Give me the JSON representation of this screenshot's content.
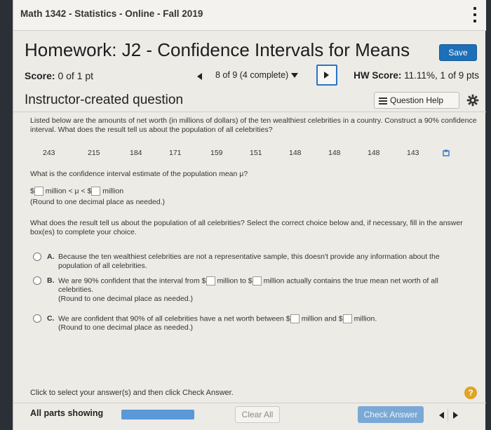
{
  "course": {
    "title": "Math 1342 - Statistics - Online - Fall 2019"
  },
  "homework": {
    "title": "Homework: J2 - Confidence Intervals for Means",
    "save_label": "Save"
  },
  "score": {
    "label": "Score:",
    "value": "0 of 1 pt"
  },
  "navigation": {
    "position": "8 of 9 (4 complete)"
  },
  "hw_score": {
    "label": "HW Score:",
    "value": "11.11%, 1 of 9 pts"
  },
  "question": {
    "type_label": "Instructor-created question",
    "help_label": "Question Help",
    "prompt": "Listed below are the amounts of net worth (in millions of dollars) of the ten wealthiest celebrities in a country. Construct a 90% confidence interval. What does the result tell us about the population of all celebrities?",
    "data_values": [
      "243",
      "215",
      "184",
      "171",
      "159",
      "151",
      "148",
      "148",
      "148",
      "143"
    ],
    "q1": "What is the confidence interval estimate of the population mean μ?",
    "interval_prefix": "$",
    "interval_mid": "million < μ < $",
    "interval_suffix": "million",
    "round_note": "(Round to one decimal place as needed.)",
    "q2": "What does the result tell us about the population of all celebrities? Select the correct choice below and, if necessary, fill in the answer box(es) to complete your choice.",
    "choices": [
      {
        "letter": "A.",
        "text": "Because the ten wealthiest celebrities are not a representative sample, this doesn't provide any information about the population of all celebrities."
      },
      {
        "letter": "B.",
        "text_a": "We are 90% confident that the interval from $",
        "text_b": "million to $",
        "text_c": "million actually contains the true mean net worth of all celebrities.",
        "note": "(Round to one decimal place as needed.)"
      },
      {
        "letter": "C.",
        "text_a": "We are confident that 90% of all celebrities have a net worth between $",
        "text_b": "million and $",
        "text_c": "million.",
        "note": "(Round to one decimal place as needed.)"
      }
    ]
  },
  "footer": {
    "hint": "Click to select your answer(s) and then click Check Answer.",
    "help_icon": "?",
    "parts_label": "All parts showing",
    "clear_label": "Clear All",
    "check_label": "Check Answer"
  },
  "colors": {
    "accent": "#1d6fb8",
    "progress": "#5a98d6",
    "help_badge": "#e0a325"
  }
}
